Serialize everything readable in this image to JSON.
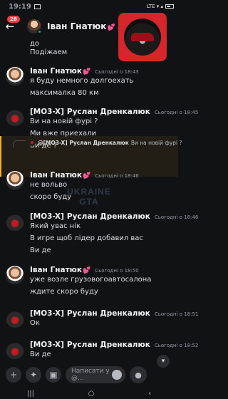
{
  "status": {
    "time": "19:19",
    "indicators": "LTE ▾ ▴"
  },
  "header": {
    "back_icon": "arrow-left-icon",
    "badge": "28",
    "title": "Іван Гнатюк",
    "heart": "💕",
    "chevron": "›"
  },
  "stub_messages": [
    "до",
    "Подіжаем"
  ],
  "messages": [
    {
      "author": "Іван Гнатюк",
      "heart": "💕",
      "tag": "",
      "time": "Сьогодні о 18:43",
      "lines": [
        "я буду немного долгоехать",
        "максималка 80 км"
      ]
    },
    {
      "author": "Руслан Дренкалюк",
      "tag": "[MO3-X]",
      "time": "Сьогодні о 18:45",
      "lines": [
        "Ви на новій фурі ?",
        "Ми вже приехали",
        "Ви де ?"
      ]
    },
    {
      "author": "Іван Гнатюк",
      "heart": "💕",
      "tag": "",
      "time": "Сьогодні о 18:46",
      "lines": [
        "не вольво",
        "скоро буду"
      ]
    },
    {
      "author": "Руслан Дренкалюк",
      "tag": "[MO3-X]",
      "time": "Сьогодні о 18:46",
      "lines": [
        "Який увас нік",
        "В игре щоб лідер добавил вас",
        "Ви де"
      ]
    },
    {
      "author": "Іван Гнатюк",
      "heart": "💕",
      "tag": "",
      "time": "Сьогодні о 18:50",
      "lines": [
        "уже возле грузовогоавтосалона",
        "ждите скоро буду"
      ]
    },
    {
      "author": "Руслан Дренкалюк",
      "tag": "[MO3-X]",
      "time": "Сьогодні о 18:51",
      "lines": [
        "Ок"
      ]
    },
    {
      "author": "Руслан Дренкалюк",
      "tag": "[MO3-X]",
      "time": "Сьогодні о 18:52",
      "lines": [
        "Ви де"
      ]
    }
  ],
  "reply": {
    "tag": "@[MO3-X]",
    "author": "Руслан Дренкалюк",
    "text": "Ви на новій фурі ?"
  },
  "watermark": {
    "line1": "UKRAINE",
    "line2": "GTA"
  },
  "input": {
    "placeholder": "Написати у @..."
  },
  "colors": {
    "background": "#111214",
    "accent_red": "#f23f43",
    "online": "#23a55a"
  }
}
